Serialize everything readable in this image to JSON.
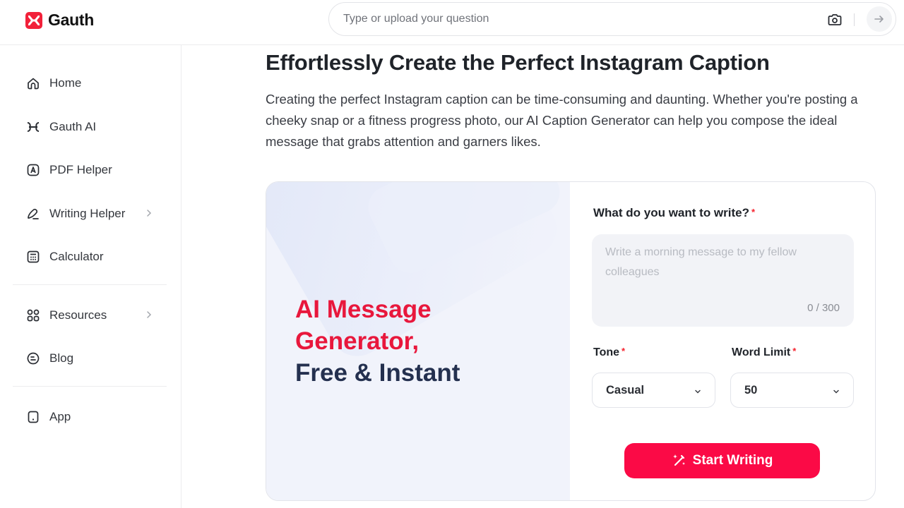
{
  "header": {
    "brand": "Gauth",
    "search_placeholder": "Type or upload your question",
    "icons": {
      "logo": "gauth-logo-icon",
      "camera": "camera-icon",
      "submit": "arrow-right-icon"
    }
  },
  "sidebar": {
    "items": [
      {
        "label": "Home",
        "icon": "home-icon",
        "has_submenu": false
      },
      {
        "label": "Gauth AI",
        "icon": "gauth-ai-icon",
        "has_submenu": false
      },
      {
        "label": "PDF Helper",
        "icon": "pdf-icon",
        "has_submenu": false
      },
      {
        "label": "Writing Helper",
        "icon": "pen-icon",
        "has_submenu": true
      },
      {
        "label": "Calculator",
        "icon": "calculator-icon",
        "has_submenu": false
      },
      {
        "label": "Resources",
        "icon": "grid-icon",
        "has_submenu": true
      },
      {
        "label": "Blog",
        "icon": "blog-icon",
        "has_submenu": false
      },
      {
        "label": "App",
        "icon": "phone-icon",
        "has_submenu": false
      }
    ]
  },
  "main": {
    "title": "Effortlessly Create the Perfect Instagram Caption",
    "description": "Creating the perfect Instagram caption can be time-consuming and daunting. Whether you're posting a cheeky snap or a fitness progress photo, our AI Caption Generator can help you compose the ideal message that grabs attention and garners likes.",
    "hero": {
      "line1": "AI Message",
      "line2": "Generator,",
      "line3": "Free & Instant"
    },
    "form": {
      "prompt_label": "What do you want to write?",
      "prompt_placeholder": "Write a morning message to my fellow colleagues",
      "prompt_value": "",
      "counter": "0 / 300",
      "required_mark": "*",
      "tone_label": "Tone",
      "tone_value": "Casual",
      "word_limit_label": "Word Limit",
      "word_limit_value": "50",
      "submit_label": "Start Writing"
    }
  },
  "colors": {
    "brand_red": "#f2213a",
    "button_red": "#fb0a46",
    "hero_red": "#e8173c",
    "hero_navy": "#24304f",
    "panel_bg": "#f1f3fb"
  }
}
